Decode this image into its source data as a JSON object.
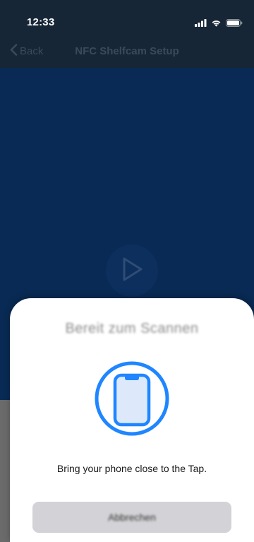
{
  "status_bar": {
    "time": "12:33",
    "icons": [
      "signal-icon",
      "wifi-icon",
      "battery-icon"
    ]
  },
  "nav": {
    "back_label": "Back",
    "title": "NFC Shelfcam Setup"
  },
  "video": {
    "play_icon": "play-icon"
  },
  "scan_sheet": {
    "title": "Bereit zum Scannen",
    "icon": "phone-nfc-icon",
    "message": "Bring your phone close to the Tap.",
    "cancel_label": "Abbrechen"
  },
  "colors": {
    "accent": "#1f86ff",
    "video_background": "#092a54",
    "navbar": "#172636",
    "sheet": "#ffffff"
  }
}
